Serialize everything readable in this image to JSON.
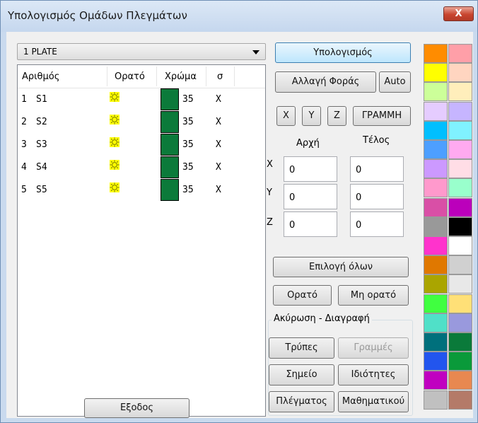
{
  "window": {
    "title": "Υπολογισμός Ομάδων Πλεγμάτων",
    "close_label": "X"
  },
  "combo": {
    "value": "1 PLATE"
  },
  "table": {
    "headers": [
      "Αριθμός",
      "Ορατό",
      "Χρώμα",
      "σ"
    ],
    "rows": [
      {
        "num": "1",
        "name": "S1",
        "color": "#0b7a3a",
        "val": "35",
        "sigma": "X"
      },
      {
        "num": "2",
        "name": "S2",
        "color": "#0b7a3a",
        "val": "35",
        "sigma": "X"
      },
      {
        "num": "3",
        "name": "S3",
        "color": "#0b7a3a",
        "val": "35",
        "sigma": "X"
      },
      {
        "num": "4",
        "name": "S4",
        "color": "#0b7a3a",
        "val": "35",
        "sigma": "X"
      },
      {
        "num": "5",
        "name": "S5",
        "color": "#0b7a3a",
        "val": "35",
        "sigma": "X"
      }
    ]
  },
  "buttons": {
    "calculate": "Υπολογισμός",
    "change_direction": "Αλλαγή Φοράς",
    "auto": "Auto",
    "x": "X",
    "y": "Y",
    "z": "Z",
    "line": "ΓΡΑΜΜΗ",
    "select_all": "Επιλογή όλων",
    "visible": "Ορατό",
    "not_visible": "Μη ορατό",
    "holes": "Τρύπες",
    "lines": "Γραμμές",
    "point": "Σημείο",
    "properties": "Ιδιότητες",
    "mesh": "Πλέγματος",
    "mathematical": "Μαθηματικού",
    "exit": "Εξοδος"
  },
  "coords": {
    "start_label": "Αρχή",
    "end_label": "Τέλος",
    "x_label": "X",
    "y_label": "Y",
    "z_label": "Z",
    "x_start": "0",
    "x_end": "0",
    "y_start": "0",
    "y_end": "0",
    "z_start": "0",
    "z_end": "0"
  },
  "group": {
    "title": "Ακύρωση - Διαγραφή"
  },
  "palette": {
    "left": [
      "#ff8c00",
      "#ffff00",
      "#ccff99",
      "#e5ccff",
      "#00bfff",
      "#4d9fff",
      "#cc99ff",
      "#ff99cc",
      "#d94fa6",
      "#999999",
      "#ff33cc",
      "#e07800",
      "#aaa500",
      "#40ff40",
      "#50e0c8",
      "#00707c",
      "#2255ee",
      "#c000c0",
      "#c0c0c0"
    ],
    "right": [
      "#ff9fa8",
      "#ffd5c0",
      "#ffeebb",
      "#c6b5ff",
      "#80f2ff",
      "#ffaaf0",
      "#ffdde6",
      "#99ffcc",
      "#bb00bb",
      "#000000",
      "#ffffff",
      "#d0d0d0",
      "#e8e8e8",
      "#ffe077",
      "#9999dd",
      "#0a7a3a",
      "#0a9a3a",
      "#e88850",
      "#b47a68"
    ]
  }
}
